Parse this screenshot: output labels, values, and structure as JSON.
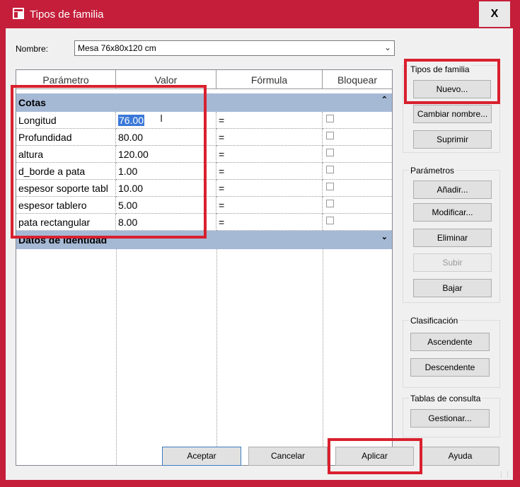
{
  "window": {
    "title": "Tipos de familia",
    "close_label": "X"
  },
  "nombre": {
    "label": "Nombre:",
    "value": "Mesa 76x80x120 cm"
  },
  "grid": {
    "headers": [
      "Parámetro",
      "Valor",
      "Fórmula",
      "Bloquear"
    ],
    "groups": [
      {
        "name": "Cotas",
        "toggle": "⌃"
      },
      {
        "name": "Datos de identidad",
        "toggle": "⌄"
      }
    ],
    "rows": [
      {
        "param": "Longitud",
        "value": "76.00",
        "formula": "="
      },
      {
        "param": "Profundidad",
        "value": "80.00",
        "formula": "="
      },
      {
        "param": "altura",
        "value": "120.00",
        "formula": "="
      },
      {
        "param": "d_borde a pata",
        "value": "1.00",
        "formula": "="
      },
      {
        "param": "espesor soporte tabl",
        "value": "10.00",
        "formula": "="
      },
      {
        "param": "espesor tablero",
        "value": "5.00",
        "formula": "="
      },
      {
        "param": "pata rectangular",
        "value": "8.00",
        "formula": "="
      }
    ]
  },
  "tipos": {
    "title": "Tipos de familia",
    "nuevo": "Nuevo...",
    "cambiar": "Cambiar nombre...",
    "suprimir": "Suprimir"
  },
  "parametros": {
    "title": "Parámetros",
    "anadir": "Añadir...",
    "modificar": "Modificar...",
    "eliminar": "Eliminar",
    "subir": "Subir",
    "bajar": "Bajar"
  },
  "clasificacion": {
    "title": "Clasificación",
    "ascendente": "Ascendente",
    "descendente": "Descendente"
  },
  "tablas": {
    "title": "Tablas de consulta",
    "gestionar": "Gestionar..."
  },
  "footer": {
    "aceptar": "Aceptar",
    "cancelar": "Cancelar",
    "aplicar": "Aplicar",
    "ayuda": "Ayuda"
  },
  "colors": {
    "frame": "#c41e3a",
    "group_header": "#a5b9d5",
    "selection": "#3a78d8",
    "highlight": "#d9202e"
  }
}
